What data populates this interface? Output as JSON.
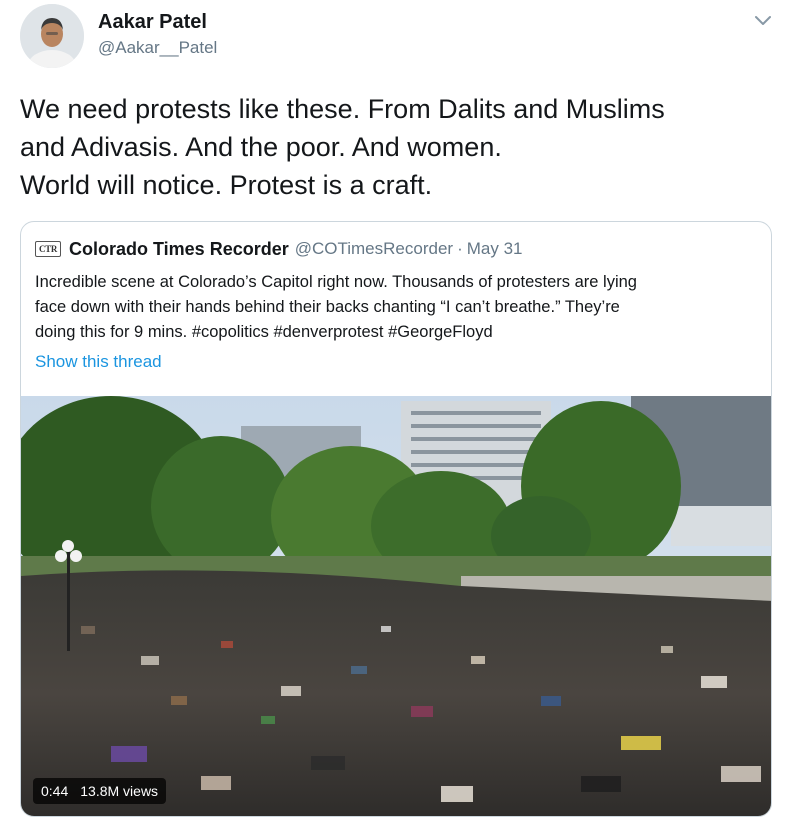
{
  "tweet": {
    "author_name": "Aakar Patel",
    "author_handle": "@Aakar__Patel",
    "text_lines": [
      "We need protests like these. From Dalits and Muslims",
      "and Adivasis. And the poor. And women.",
      "World will notice. Protest is a craft."
    ]
  },
  "quote": {
    "avatar_text": "CTR",
    "name": "Colorado Times Recorder",
    "handle": "@COTimesRecorder",
    "separator": "·",
    "date": "May 31",
    "text_lines": [
      "Incredible scene at Colorado’s Capitol right now. Thousands of protesters are lying",
      "face down with their hands behind their backs chanting “I can’t breathe.” They’re",
      "doing this for 9 mins. #copolitics #denverprotest #GeorgeFloyd"
    ],
    "show_thread": "Show this thread"
  },
  "video": {
    "duration": "0:44",
    "views": "13.8M views"
  },
  "icons": {
    "menu": "chevron-down-icon",
    "avatar": "user-avatar",
    "quote_logo": "ctr-logo"
  },
  "colors": {
    "link": "#1b95e0",
    "secondary_text": "#657786",
    "border": "#ccd6dd"
  }
}
